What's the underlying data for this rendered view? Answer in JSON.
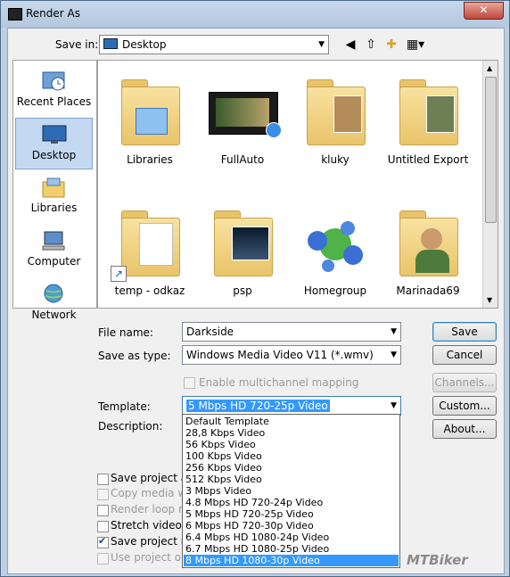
{
  "window": {
    "title": "Render As",
    "close": "✕"
  },
  "savein": {
    "label": "Save in:",
    "value": "Desktop"
  },
  "places": [
    {
      "label": "Recent Places",
      "icon": "recent-places-icon"
    },
    {
      "label": "Desktop",
      "icon": "desktop-icon",
      "selected": true
    },
    {
      "label": "Libraries",
      "icon": "libraries-icon"
    },
    {
      "label": "Computer",
      "icon": "computer-icon"
    },
    {
      "label": "Network",
      "icon": "network-icon"
    }
  ],
  "files": [
    {
      "label": "Libraries",
      "icon": "libraries-folder-icon"
    },
    {
      "label": "FullAuto",
      "icon": "video-file-icon"
    },
    {
      "label": "kluky",
      "icon": "folder-icon"
    },
    {
      "label": "Untitled Export",
      "icon": "folder-icon"
    },
    {
      "label": "temp - odkaz",
      "icon": "folder-shortcut-icon"
    },
    {
      "label": "psp",
      "icon": "folder-icon"
    },
    {
      "label": "Homegroup",
      "icon": "homegroup-icon"
    },
    {
      "label": "Marinada69",
      "icon": "user-folder-icon"
    }
  ],
  "form": {
    "filename_label": "File name:",
    "filename_value": "Darkside",
    "savetype_label": "Save as type:",
    "savetype_value": "Windows Media Video V11 (*.wmv)",
    "multichannel_label": "Enable multichannel mapping",
    "template_label": "Template:",
    "template_value": "5 Mbps HD 720-25p Video",
    "description_label": "Description:"
  },
  "buttons": {
    "save": "Save",
    "cancel": "Cancel",
    "channels": "Channels...",
    "custom": "Custom...",
    "about": "About..."
  },
  "options": [
    {
      "label": "Save project as p",
      "checked": false,
      "enabled": true
    },
    {
      "label": "Copy media with",
      "checked": false,
      "enabled": false
    },
    {
      "label": "Render loop regi",
      "checked": false,
      "enabled": true
    },
    {
      "label": "Stretch video to f",
      "checked": false,
      "enabled": true
    },
    {
      "label": "Save project mar",
      "checked": true,
      "enabled": true
    },
    {
      "label": "Use project outpu",
      "checked": false,
      "enabled": false
    }
  ],
  "template_options": [
    "Default Template",
    "28,8 Kbps Video",
    "56 Kbps Video",
    "100 Kbps Video",
    "256 Kbps Video",
    "512 Kbps Video",
    "3 Mbps Video",
    "4.8 Mbps HD 720-24p Video",
    "5 Mbps HD 720-25p Video",
    "6 Mbps HD 720-30p Video",
    "6.4 Mbps HD 1080-24p Video",
    "6.7 Mbps HD 1080-25p Video",
    "8 Mbps HD 1080-30p Video"
  ],
  "template_highlighted_index": 12,
  "watermark": {
    "prefix": "",
    "brand": "MTBiker"
  }
}
